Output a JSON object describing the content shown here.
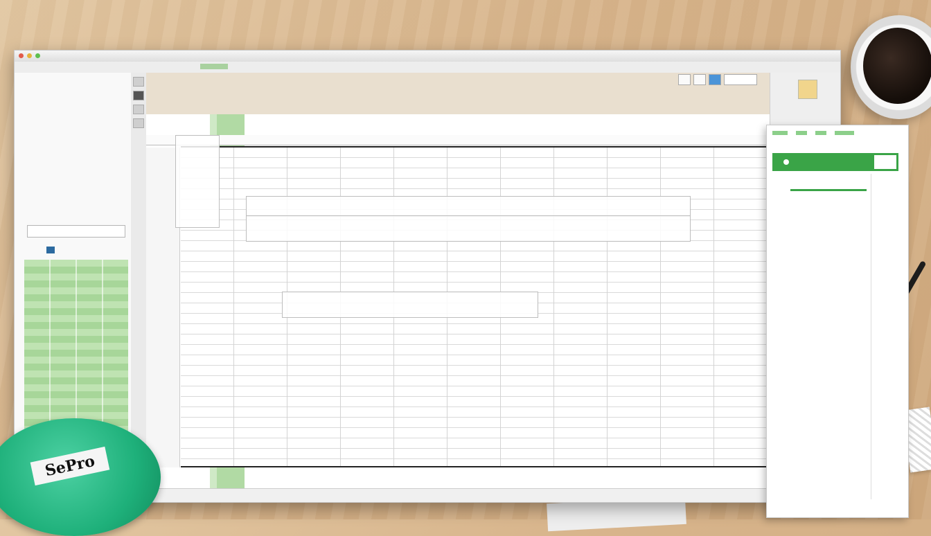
{
  "window": {
    "title": ""
  },
  "left_pane": {
    "rows": [
      [
        "",
        ""
      ],
      [
        "",
        ""
      ],
      [
        "",
        ""
      ],
      [
        "",
        ""
      ],
      [
        "",
        ""
      ],
      [
        "",
        ""
      ],
      [
        "",
        ""
      ],
      [
        "",
        ""
      ],
      [
        "",
        ""
      ],
      [
        "",
        ""
      ],
      [
        "",
        ""
      ],
      [
        "",
        ""
      ],
      [
        "",
        ""
      ],
      [
        "",
        ""
      ],
      [
        "",
        ""
      ]
    ],
    "footer": {
      "left": "",
      "middle": ""
    }
  },
  "document": {
    "title": "",
    "sub": ""
  },
  "row_numbers": [
    "",
    "",
    "",
    "",
    "",
    "",
    "",
    "",
    "",
    "",
    "",
    "",
    "",
    "",
    "",
    "",
    "",
    "",
    "",
    "",
    "",
    "",
    "",
    "",
    "",
    "",
    "",
    "",
    ""
  ],
  "callouts": [],
  "side_panel": {
    "header": ""
  },
  "sticker": {
    "label": "SePro"
  },
  "colors": {
    "accent_green": "#3aa447",
    "highlight_green": "#a8d69a",
    "selection_blue": "#4b94d8"
  }
}
